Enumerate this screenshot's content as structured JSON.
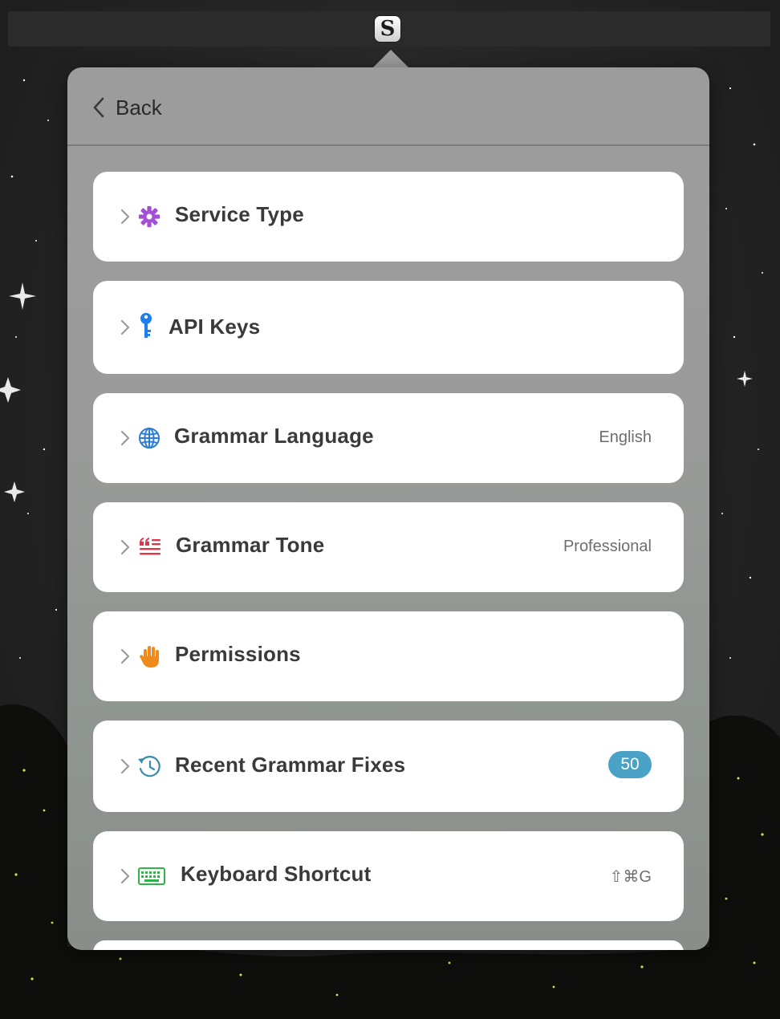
{
  "app_icon": {
    "letter": "S",
    "name": "s-app-icon"
  },
  "header": {
    "back_label": "Back"
  },
  "items": [
    {
      "label": "Service Type",
      "icon": "gear-icon",
      "color": "#a34fd6"
    },
    {
      "label": "API Keys",
      "icon": "key-icon",
      "color": "#1e7ff0"
    },
    {
      "label": "Grammar Language",
      "icon": "globe-icon",
      "color": "#2a7ed6",
      "value": "English"
    },
    {
      "label": "Grammar Tone",
      "icon": "quote-lines-icon",
      "color": "#e0344a",
      "value": "Professional"
    },
    {
      "label": "Permissions",
      "icon": "hand-icon",
      "color": "#f08a1c"
    },
    {
      "label": "Recent Grammar Fixes",
      "icon": "history-icon",
      "color": "#3a8bb0",
      "badge": "50"
    },
    {
      "label": "Keyboard Shortcut",
      "icon": "keyboard-icon",
      "color": "#2fb34a",
      "value": "⇧⌘G"
    }
  ]
}
